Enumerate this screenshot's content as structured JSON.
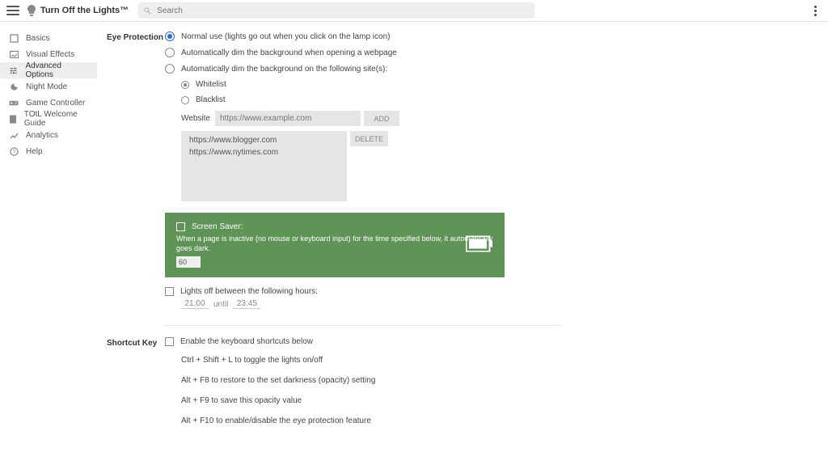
{
  "header": {
    "title": "Turn Off the Lights™",
    "search_placeholder": "Search"
  },
  "sidebar": {
    "items": [
      {
        "label": "Basics"
      },
      {
        "label": "Visual Effects"
      },
      {
        "label": "Advanced Options"
      },
      {
        "label": "Night Mode"
      },
      {
        "label": "Game Controller"
      },
      {
        "label": "TOtL Welcome Guide"
      },
      {
        "label": "Analytics"
      },
      {
        "label": "Help"
      }
    ]
  },
  "eye_protection": {
    "heading": "Eye Protection",
    "opt_normal": "Normal use (lights go out when you click on the lamp icon)",
    "opt_auto_open": "Automatically dim the background when opening a webpage",
    "opt_auto_sites": "Automatically dim the background on the following site(s):",
    "whitelist": "Whitelist",
    "blacklist": "Blacklist",
    "website_label": "Website",
    "website_placeholder": "https://www.example.com",
    "add_btn": "ADD",
    "delete_btn": "DELETE",
    "sites": [
      "https://www.blogger.com",
      "https://www.nytimes.com"
    ]
  },
  "screen_saver": {
    "label": "Screen Saver:",
    "desc": "When a page is inactive (no mouse or keyboard input) for the time specified below, it automatically goes dark.",
    "value": "60"
  },
  "hours": {
    "label": "Lights off between the following hours:",
    "from": "21:00",
    "until_label": "until",
    "to": "23:45"
  },
  "shortcut": {
    "heading": "Shortcut Key",
    "enable": "Enable the keyboard shortcuts below",
    "lines": [
      "Ctrl + Shift + L to toggle the lights on/off",
      "Alt + F8 to restore to the set darkness (opacity) setting",
      "Alt + F9 to save this opacity value",
      "Alt + F10 to enable/disable the eye protection feature"
    ]
  }
}
